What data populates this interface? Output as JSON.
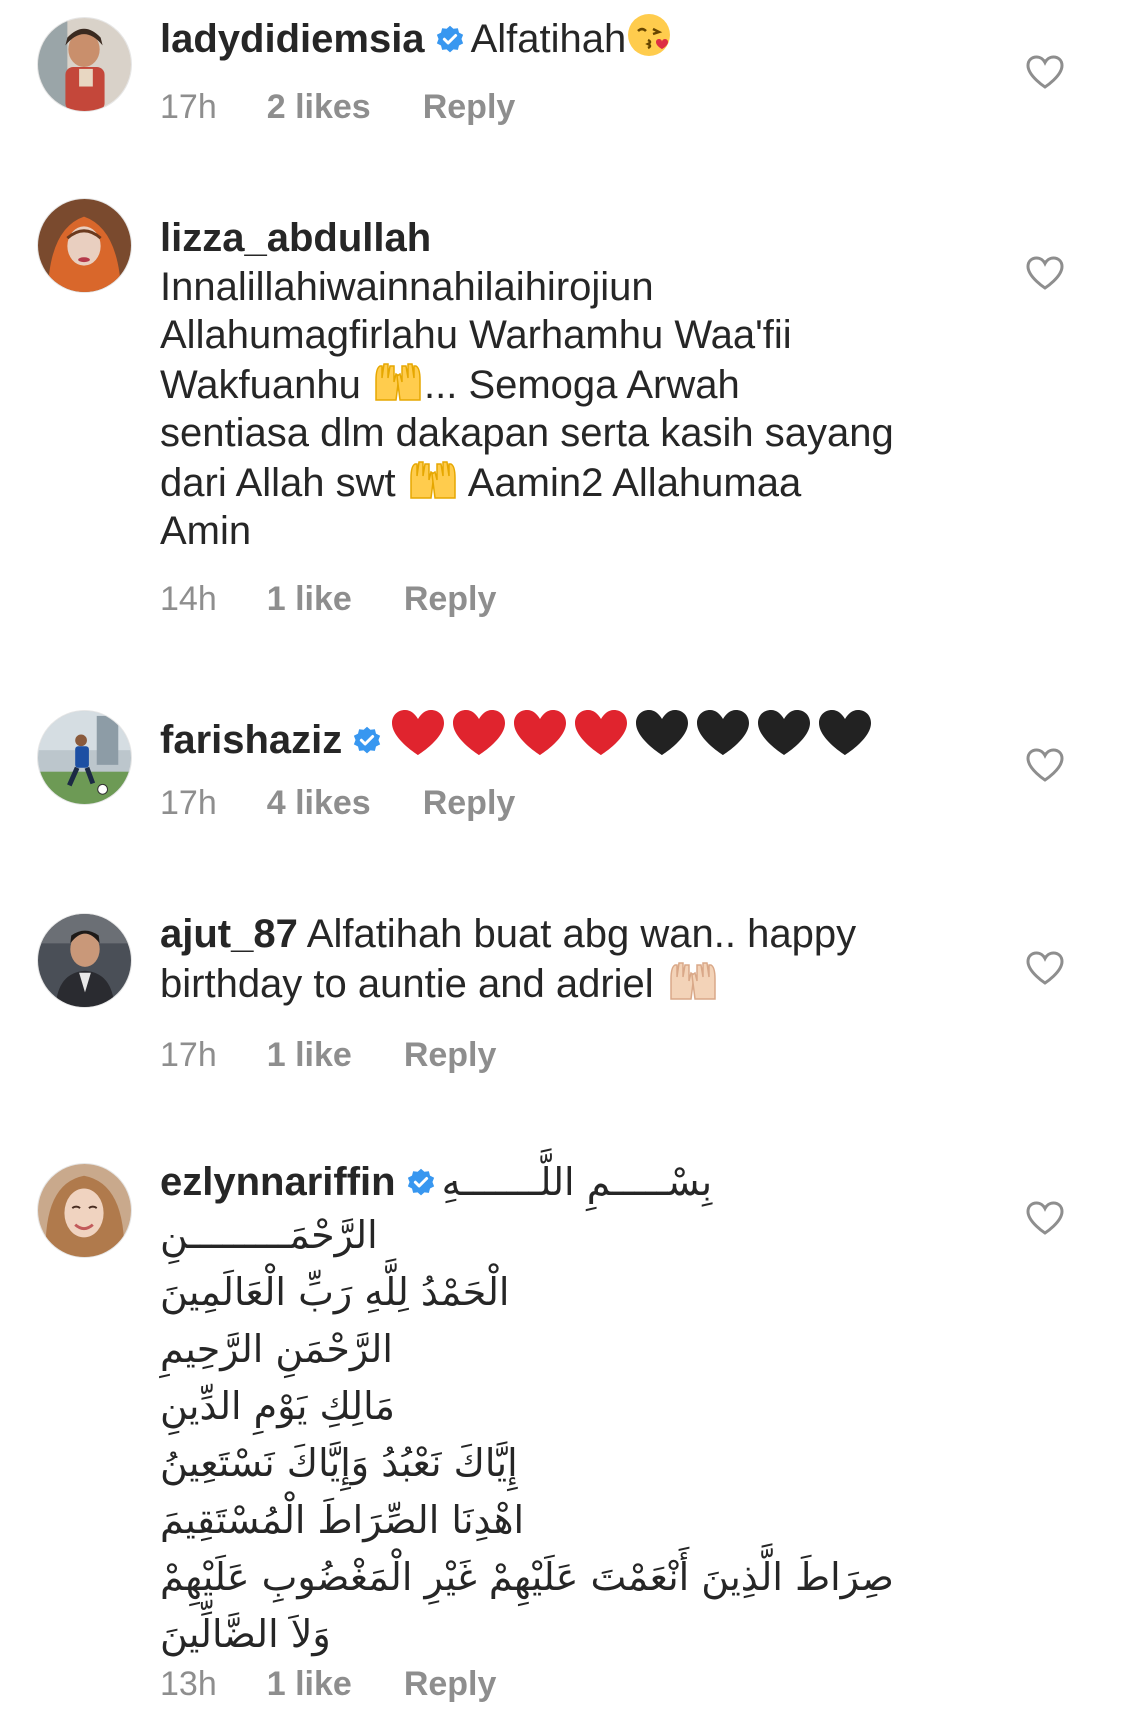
{
  "comments": [
    {
      "username": "ladydidiemsia",
      "verified": true,
      "text": "Alfatihah",
      "emoji": "kissing-face-emoji",
      "time": "17h",
      "likes": "2 likes",
      "reply": "Reply"
    },
    {
      "username": "lizza_abdullah",
      "verified": false,
      "lines": [
        "Innalillahiwainnahilaihirojiun",
        "Allahumagfirlahu Warhamhu Waa'fii",
        "Wakfuanhu",
        "... Semoga Arwah",
        "sentiasa dlm dakapan serta kasih sayang",
        "dari Allah swt",
        "Aamin2 Allahumaa",
        "Amin"
      ],
      "time": "14h",
      "likes": "1 like",
      "reply": "Reply"
    },
    {
      "username": "farishaziz",
      "verified": true,
      "emoji": "red-and-black-hearts-emoji",
      "time": "17h",
      "likes": "4 likes",
      "reply": "Reply"
    },
    {
      "username": "ajut_87",
      "verified": false,
      "text_line1": "Alfatihah buat abg wan.. happy",
      "text_line2": "birthday to auntie and adriel",
      "time": "17h",
      "likes": "1 like",
      "reply": "Reply"
    },
    {
      "username": "ezlynnariffin",
      "verified": true,
      "arabic_first": "بِسْـــــمِ اللَّـــــــهِ",
      "arabic_lines": [
        "الرَّحْمَـــــــــنِ",
        "الْحَمْدُ لِلَّهِ رَبِّ الْعَالَمِينَ",
        "الرَّحْمَنِ الرَّحِيمِ",
        "مَالِكِ يَوْمِ الدِّينِ",
        "إِيَّاكَ نَعْبُدُ وَإِيَّاكَ نَسْتَعِينُ",
        "اهْدِنَا الصِّرَاطَ الْمُسْتَقِيمَ",
        "صِرَاطَ الَّذِينَ أَنْعَمْتَ عَلَيْهِمْ غَيْرِ الْمَغْضُوبِ عَلَيْهِمْ",
        "وَلاَ الضَّالِّينَ"
      ],
      "time": "13h",
      "likes": "1 like",
      "reply": "Reply"
    }
  ],
  "colors": {
    "text": "#262626",
    "meta": "#8e8e8e",
    "verified": "#3897f0",
    "heart_outline": "#8e8e8e"
  }
}
